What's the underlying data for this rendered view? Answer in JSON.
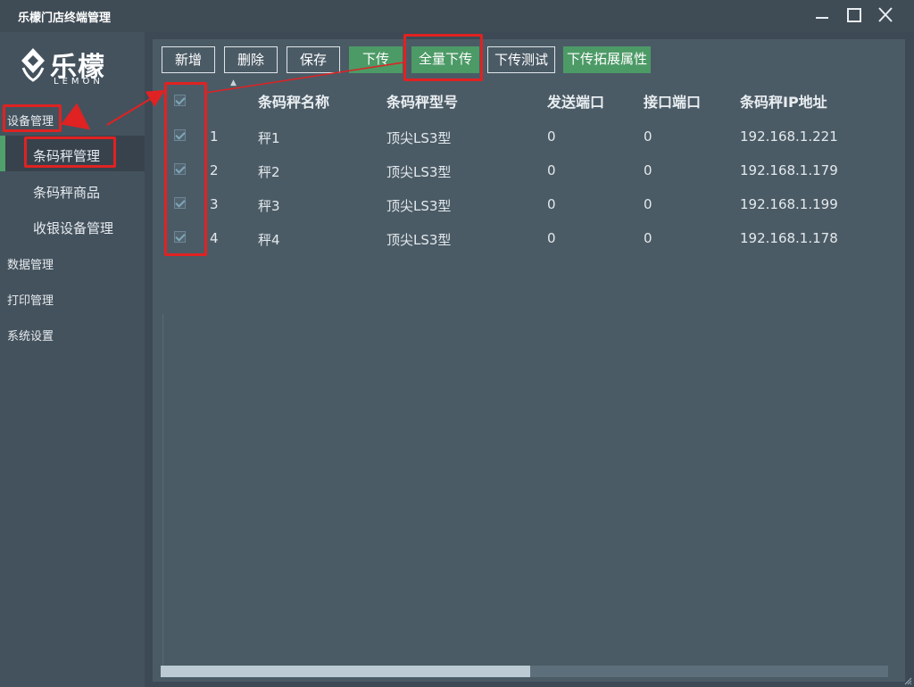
{
  "window": {
    "title": "乐檬门店终端管理",
    "controls": [
      "minimize",
      "maximize",
      "close"
    ]
  },
  "logo": {
    "cn": "乐檬",
    "en": "LEMON"
  },
  "sidebar": {
    "groups": [
      {
        "label": "设备管理",
        "items": [
          "条码秤管理",
          "条码秤商品",
          "收银设备管理"
        ]
      },
      {
        "label": "数据管理"
      },
      {
        "label": "打印管理"
      },
      {
        "label": "系统设置"
      }
    ],
    "active_item": "条码秤管理"
  },
  "toolbar": {
    "add": "新增",
    "delete": "删除",
    "save": "保存",
    "download": "下传",
    "download_all": "全量下传",
    "download_test": "下传测试",
    "download_ext": "下传拓展属性"
  },
  "table": {
    "headers": [
      "条码秤名称",
      "条码秤型号",
      "发送端口",
      "接口端口",
      "条码秤IP地址"
    ],
    "rows": [
      {
        "no": "1",
        "name": "秤1",
        "model": "顶尖LS3型",
        "send_port": "0",
        "if_port": "0",
        "ip": "192.168.1.221"
      },
      {
        "no": "2",
        "name": "秤2",
        "model": "顶尖LS3型",
        "send_port": "0",
        "if_port": "0",
        "ip": "192.168.1.179"
      },
      {
        "no": "3",
        "name": "秤3",
        "model": "顶尖LS3型",
        "send_port": "0",
        "if_port": "0",
        "ip": "192.168.1.199"
      },
      {
        "no": "4",
        "name": "秤4",
        "model": "顶尖LS3型",
        "send_port": "0",
        "if_port": "0",
        "ip": "192.168.1.178"
      }
    ]
  },
  "colors": {
    "accent_green": "#4c9a66",
    "annotation_red": "#e02222",
    "panel": "#4b5b66",
    "sidebar": "#44525d"
  }
}
